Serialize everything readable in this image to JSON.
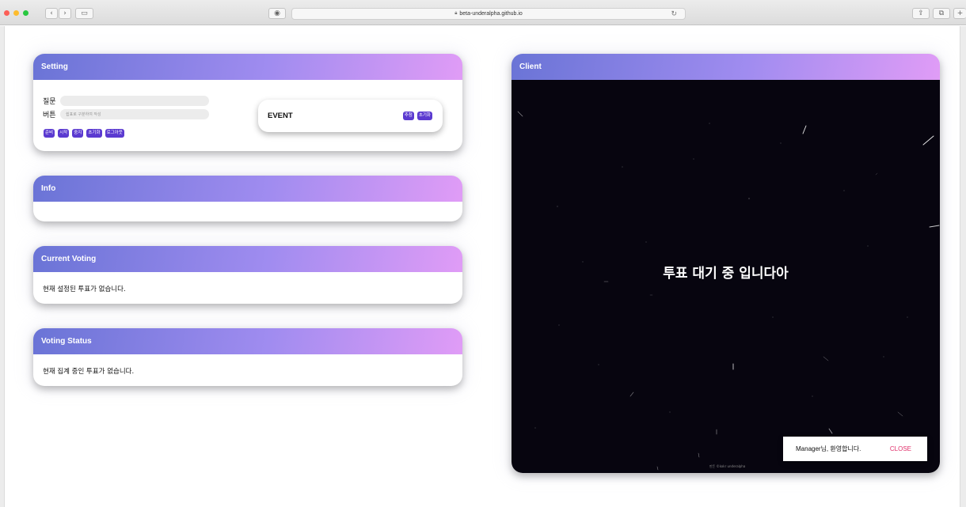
{
  "browser": {
    "url": "beta-underalpha.github.io",
    "lock_icon": "lock-icon",
    "reload_icon": "reload-icon"
  },
  "setting": {
    "title": "Setting",
    "question_label": "질문",
    "question_value": "",
    "button_label": "버튼",
    "button_placeholder": "쉼표로 구분하여 작성",
    "buttons": [
      "준비",
      "시작",
      "중지",
      "초기화",
      "로그아웃"
    ],
    "event": {
      "title": "EVENT",
      "buttons": [
        "추첨",
        "초기화"
      ]
    }
  },
  "info": {
    "title": "Info"
  },
  "current_voting": {
    "title": "Current Voting",
    "message": "현재 설정된 투표가 없습니다."
  },
  "voting_status": {
    "title": "Voting Status",
    "message": "현재 집계 중인 투표가 없습니다."
  },
  "client": {
    "title": "Client",
    "waiting_text": "투표 대기 중 입니다아",
    "credit": "만든 ©kokr underalpha"
  },
  "snackbar": {
    "message": "Manager님, 환영합니다.",
    "close_label": "CLOSE"
  },
  "colors": {
    "header_gradient_start": "#6a74d6",
    "header_gradient_end": "#e09cf6",
    "button_purple": "#5b3ad0",
    "close_pink": "#e0306a",
    "client_bg": "#07050f"
  }
}
